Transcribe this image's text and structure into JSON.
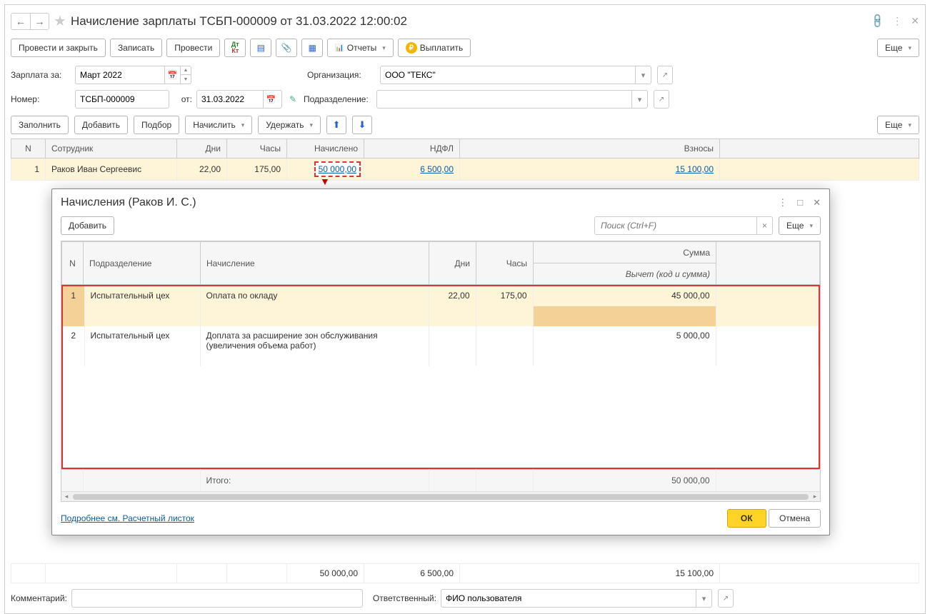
{
  "header": {
    "title": "Начисление зарплаты ТСБП-000009 от 31.03.2022 12:00:02"
  },
  "toolbar": {
    "post_close": "Провести и закрыть",
    "write": "Записать",
    "post": "Провести",
    "reports": "Отчеты",
    "pay": "Выплатить",
    "more": "Еще"
  },
  "form": {
    "salary_for_label": "Зарплата за:",
    "salary_for_value": "Март 2022",
    "org_label": "Организация:",
    "org_value": "ООО \"ТЕКС\"",
    "number_label": "Номер:",
    "number_value": "ТСБП-000009",
    "from_label": "от:",
    "date_value": "31.03.2022",
    "dept_label": "Подразделение:"
  },
  "subtoolbar": {
    "fill": "Заполнить",
    "add": "Добавить",
    "select": "Подбор",
    "accrue": "Начислить",
    "withhold": "Удержать",
    "more": "Еще"
  },
  "table": {
    "headers": {
      "n": "N",
      "employee": "Сотрудник",
      "days": "Дни",
      "hours": "Часы",
      "accrued": "Начислено",
      "tax": "НДФЛ",
      "contributions": "Взносы"
    },
    "rows": [
      {
        "n": "1",
        "employee": "Раков Иван Сергеевис",
        "days": "22,00",
        "hours": "175,00",
        "accrued": "50 000,00",
        "tax": "6 500,00",
        "contributions": "15 100,00"
      }
    ],
    "totals": {
      "accrued": "50 000,00",
      "tax": "6 500,00",
      "contributions": "15 100,00"
    }
  },
  "popup": {
    "title": "Начисления (Раков И. С.)",
    "add": "Добавить",
    "search_placeholder": "Поиск (Ctrl+F)",
    "more": "Еще",
    "headers": {
      "n": "N",
      "dept": "Подразделение",
      "accrual": "Начисление",
      "days": "Дни",
      "hours": "Часы",
      "sum": "Сумма",
      "deduct": "Вычет (код и сумма)"
    },
    "rows": [
      {
        "n": "1",
        "dept": "Испытательный цех",
        "accrual": "Оплата по окладу",
        "days": "22,00",
        "hours": "175,00",
        "sum": "45 000,00"
      },
      {
        "n": "2",
        "dept": "Испытательный цех",
        "accrual": "Доплата за расширение зон обслуживания (увеличения объема работ)",
        "days": "",
        "hours": "",
        "sum": "5 000,00"
      }
    ],
    "footer_label": "Итого:",
    "footer_sum": "50 000,00",
    "link": "Подробнее см. Расчетный листок",
    "ok": "ОК",
    "cancel": "Отмена"
  },
  "bottom": {
    "comment_label": "Комментарий:",
    "resp_label": "Ответственный:",
    "resp_value": "ФИО пользователя"
  }
}
